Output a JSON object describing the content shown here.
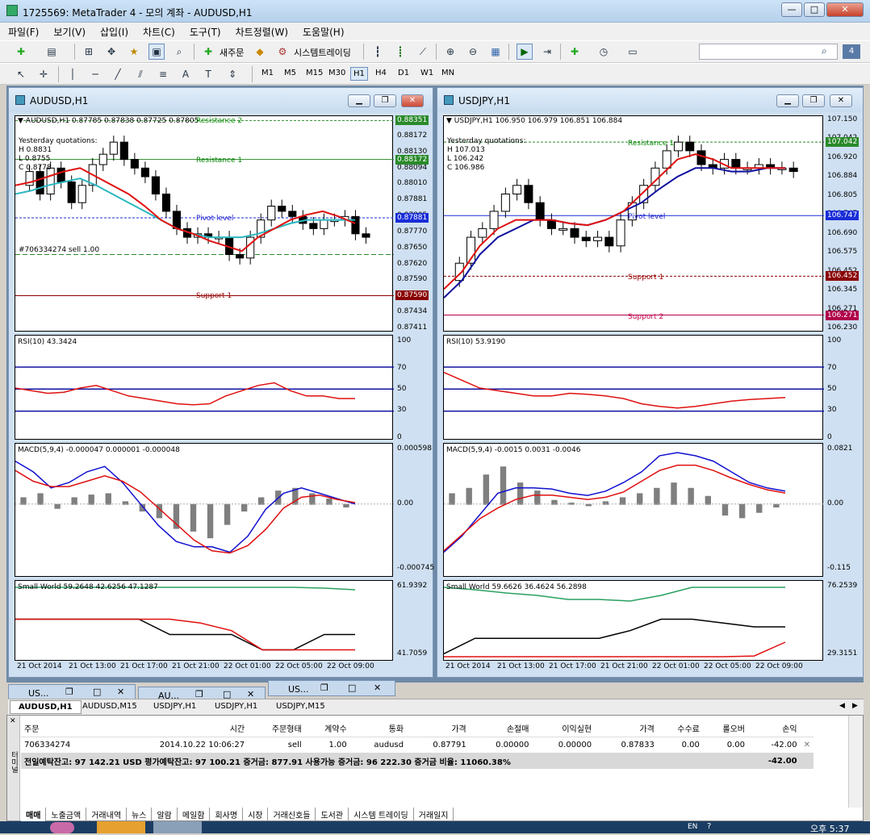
{
  "window": {
    "title": "1725569: MetaTrader 4 - 모의 계좌 - AUDUSD,H1",
    "min": "—",
    "max": "□",
    "close": "✕"
  },
  "menu": [
    "파일(F)",
    "보기(V)",
    "삽입(I)",
    "차트(C)",
    "도구(T)",
    "차트정렬(W)",
    "도움말(H)"
  ],
  "toolbar": {
    "new_order": "새주문",
    "expert_trading": "시스템트레이딩",
    "search_placeholder": "",
    "notify_count": "4",
    "timeframes": [
      "M1",
      "M5",
      "M15",
      "M30",
      "H1",
      "H4",
      "D1",
      "W1",
      "MN"
    ],
    "draw_letters": [
      "A",
      "T"
    ]
  },
  "charts": [
    {
      "title": "AUDUSD,H1",
      "info": "▼ AUDUSD,H1  0.87785 0.87838 0.87725 0.87805",
      "yesterday": [
        "Yesterday quotations:",
        "H 0.8831",
        "L 0.8755",
        "C 0.8778"
      ],
      "order_label": "#706334274 sell 1.00",
      "levels": [
        {
          "name": "Resistance 2",
          "price": "0.88351",
          "color": "#0a8a0a"
        },
        {
          "name": "Resistance 1",
          "price": "0.88172",
          "color": "#0a8a0a"
        },
        {
          "name": "Pivot level",
          "price": "0.87881",
          "color": "#1d1dd0"
        },
        {
          "name": "Support 1",
          "price": "0.87590",
          "color": "#9a0000"
        }
      ],
      "prices": [
        "0.88351",
        "0.88172",
        "0.88130",
        "0.88094",
        "0.88010",
        "0.87881",
        "0.87805",
        "0.87770",
        "0.87650",
        "0.87620",
        "0.87590",
        "0.87530",
        "0.87434",
        "0.87411"
      ],
      "rsi": {
        "label": "RSI(10) 43.3424",
        "ticks": [
          "100",
          "70",
          "50",
          "30",
          "0"
        ]
      },
      "macd": {
        "label": "MACD(5,9,4) -0.000047 0.000001 -0.000048",
        "ticks": [
          "0.000598",
          "0.00",
          "-0.000745"
        ]
      },
      "sw": {
        "label": "Small World 59.2648 42.6256 47.1287",
        "ticks": [
          "61.9392",
          "41.7059"
        ]
      },
      "dates": [
        "21 Oct 2014",
        "21 Oct 13:00",
        "21 Oct 17:00",
        "21 Oct 21:00",
        "22 Oct 01:00",
        "22 Oct 05:00",
        "22 Oct 09:00"
      ]
    },
    {
      "title": "USDJPY,H1",
      "info": "▼ USDJPY,H1  106.950 106.979 106.851 106.884",
      "yesterday": [
        "Yesterday quotations:",
        "H 107.013",
        "L 106.242",
        "C 106.986"
      ],
      "levels": [
        {
          "name": "Resistance 1",
          "price": "107.042",
          "color": "#0a8a0a"
        },
        {
          "name": "Pivot level",
          "price": "106.747",
          "color": "#1d1dd0"
        },
        {
          "name": "Support 1",
          "price": "106.452",
          "color": "#9a0000"
        },
        {
          "name": "Support 2",
          "price": "106.271",
          "color": "#c0004a"
        }
      ],
      "prices": [
        "107.150",
        "107.042",
        "106.920",
        "106.884",
        "106.805",
        "106.747",
        "106.690",
        "106.575",
        "106.452",
        "106.345",
        "106.271",
        "106.230"
      ],
      "rsi": {
        "label": "RSI(10) 53.9190",
        "ticks": [
          "100",
          "70",
          "50",
          "30",
          "0"
        ]
      },
      "macd": {
        "label": "MACD(5,9,4) -0.0015 0.0031 -0.0046",
        "ticks": [
          "0.0821",
          "0.00",
          "-0.115"
        ]
      },
      "sw": {
        "label": "Small World 59.6626 36.4624 56.2898",
        "ticks": [
          "76.2539",
          "29.3151"
        ]
      },
      "dates": [
        "21 Oct 2014",
        "21 Oct 13:00",
        "21 Oct 17:00",
        "21 Oct 21:00",
        "22 Oct 01:00",
        "22 Oct 05:00",
        "22 Oct 09:00"
      ]
    }
  ],
  "minimized": [
    "US...",
    "AU...",
    "US..."
  ],
  "chart_tabs": [
    "AUDUSD,H1",
    "AUDUSD,M15",
    "USDJPY,H1",
    "USDJPY,H1",
    "USDJPY,M15"
  ],
  "terminal": {
    "headers": [
      "주문",
      "시간",
      "주문형태",
      "계약수",
      "통화",
      "가격",
      "손절매",
      "이익실현",
      "가격",
      "수수료",
      "롤오버",
      "손익"
    ],
    "row": [
      "706334274",
      "2014.10.22 10:06:27",
      "sell",
      "1.00",
      "audusd",
      "0.87791",
      "0.00000",
      "0.00000",
      "0.87833",
      "0.00",
      "0.00",
      "-42.00"
    ],
    "summary": "전일예탁잔고: 97 142.21 USD  평가예탁잔고: 97 100.21  증거금: 877.91  사용가능 증거금: 96 222.30  증거금 비율: 11060.38%",
    "summary_total": "-42.00",
    "side_label": "터미널",
    "tabs": [
      "매매",
      "노출금액",
      "거래내역",
      "뉴스",
      "알람",
      "메일함",
      "회사명",
      "시장",
      "거래신호들",
      "도서관",
      "시스템 트레이딩",
      "거래일지"
    ]
  },
  "taskbar": {
    "lang": "EN",
    "time": "오후 5:37"
  }
}
